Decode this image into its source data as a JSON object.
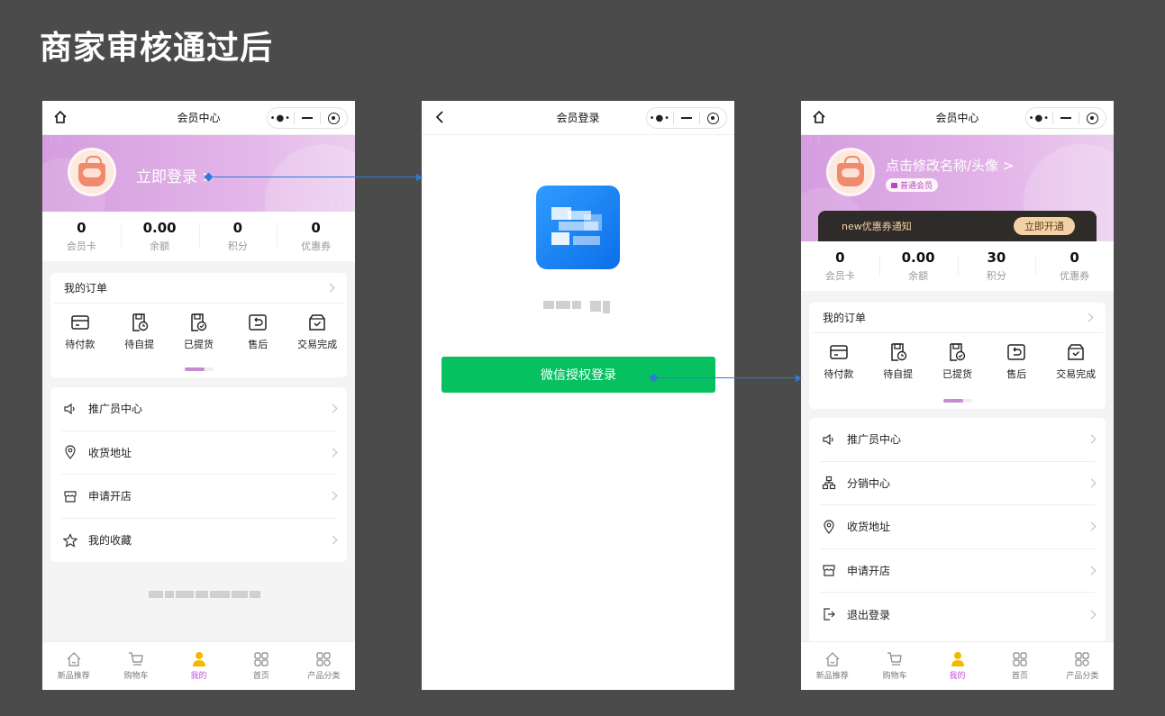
{
  "page_title": "商家审核通过后",
  "phone1": {
    "nav_title": "会员中心",
    "login_text": "立即登录 >",
    "stats": [
      {
        "num": "0",
        "label": "会员卡"
      },
      {
        "num": "0.00",
        "label": "余额"
      },
      {
        "num": "0",
        "label": "积分"
      },
      {
        "num": "0",
        "label": "优惠券"
      }
    ],
    "order_title": "我的订单",
    "orders": [
      "待付款",
      "待自提",
      "已提货",
      "售后",
      "交易完成"
    ],
    "menu": [
      "推广员中心",
      "收货地址",
      "申请开店",
      "我的收藏"
    ]
  },
  "phone2": {
    "nav_title": "会员登录",
    "wx_button": "微信授权登录"
  },
  "phone3": {
    "nav_title": "会员中心",
    "user_text": "点击修改名称/头像 >",
    "member_level": "普通会员",
    "coupon_text": "new优惠券通知",
    "coupon_button": "立即开通",
    "stats": [
      {
        "num": "0",
        "label": "会员卡"
      },
      {
        "num": "0.00",
        "label": "余额"
      },
      {
        "num": "30",
        "label": "积分"
      },
      {
        "num": "0",
        "label": "优惠券"
      }
    ],
    "order_title": "我的订单",
    "orders": [
      "待付款",
      "待自提",
      "已提货",
      "售后",
      "交易完成"
    ],
    "menu": [
      "推广员中心",
      "分销中心",
      "收货地址",
      "申请开店",
      "退出登录"
    ]
  },
  "tabbar": [
    "新品推荐",
    "购物车",
    "我的",
    "首页",
    "产品分类"
  ],
  "colors": {
    "accent": "#c04fd6",
    "banner": "#d59ddf",
    "wechat_green": "#07c160",
    "arrow": "#2d7bd8"
  }
}
